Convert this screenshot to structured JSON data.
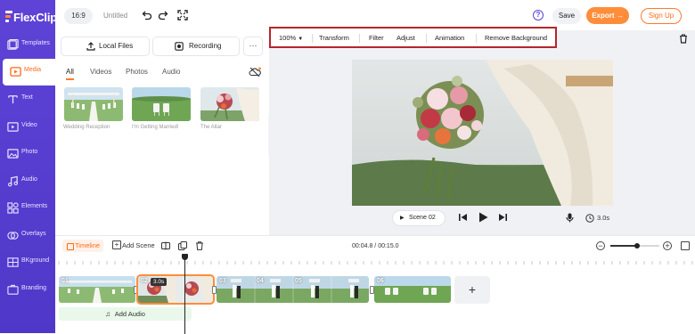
{
  "app": {
    "logo_text": "FlexClip"
  },
  "sidebar": {
    "items": [
      {
        "label": "Templates",
        "icon": "templates-icon",
        "active": false
      },
      {
        "label": "Media",
        "icon": "media-icon",
        "active": true
      },
      {
        "label": "Text",
        "icon": "text-icon",
        "active": false
      },
      {
        "label": "Video",
        "icon": "video-icon",
        "active": false
      },
      {
        "label": "Photo",
        "icon": "photo-icon",
        "active": false
      },
      {
        "label": "Audio",
        "icon": "audio-icon",
        "active": false
      },
      {
        "label": "Elements",
        "icon": "elements-icon",
        "active": false
      },
      {
        "label": "Overlays",
        "icon": "overlays-icon",
        "active": false
      },
      {
        "label": "BKground",
        "icon": "background-icon",
        "active": false
      },
      {
        "label": "Branding",
        "icon": "branding-icon",
        "active": false
      }
    ]
  },
  "topbar": {
    "aspect_ratio": "16:9",
    "project_title": "Untitled",
    "undo_icon": "undo-icon",
    "redo_icon": "redo-icon",
    "fullscreen_icon": "fullscreen-icon",
    "help_label": "?",
    "save_label": "Save",
    "export_label": "Export →",
    "signup_label": "Sign Up"
  },
  "media": {
    "local_files_label": "Local Files",
    "recording_label": "Recording",
    "more_label": "···",
    "tabs": [
      "All",
      "Videos",
      "Photos",
      "Audio"
    ],
    "active_tab": "All",
    "thumbnails": [
      {
        "caption": "Wedding Reception"
      },
      {
        "caption": "I'm Getting Married!"
      },
      {
        "caption": "The Altar"
      }
    ]
  },
  "editor": {
    "toolbar": {
      "zoom": "100%",
      "items": [
        "Transform",
        "Filter",
        "Adjust",
        "Animation",
        "Remove Background"
      ]
    },
    "scene_label": "Scene",
    "scene_number": "02",
    "duration": "3.0s"
  },
  "timeline": {
    "label": "Timeline",
    "add_scene_label": "Add Scene",
    "time_display": "00:04.8 / 00:15.0",
    "zoom_level": 0.55,
    "clips": [
      {
        "num": "01"
      },
      {
        "num": "02",
        "duration": "3.0s",
        "selected": true
      },
      {
        "num": "03"
      },
      {
        "num": "04"
      },
      {
        "num": "05"
      },
      {
        "num": "06"
      }
    ],
    "add_clip_label": "+",
    "add_audio_label": "Add Audio"
  },
  "colors": {
    "sidebar": "#5e43d6",
    "accent": "#ff8d3a",
    "highlight_box": "#b4262b"
  }
}
